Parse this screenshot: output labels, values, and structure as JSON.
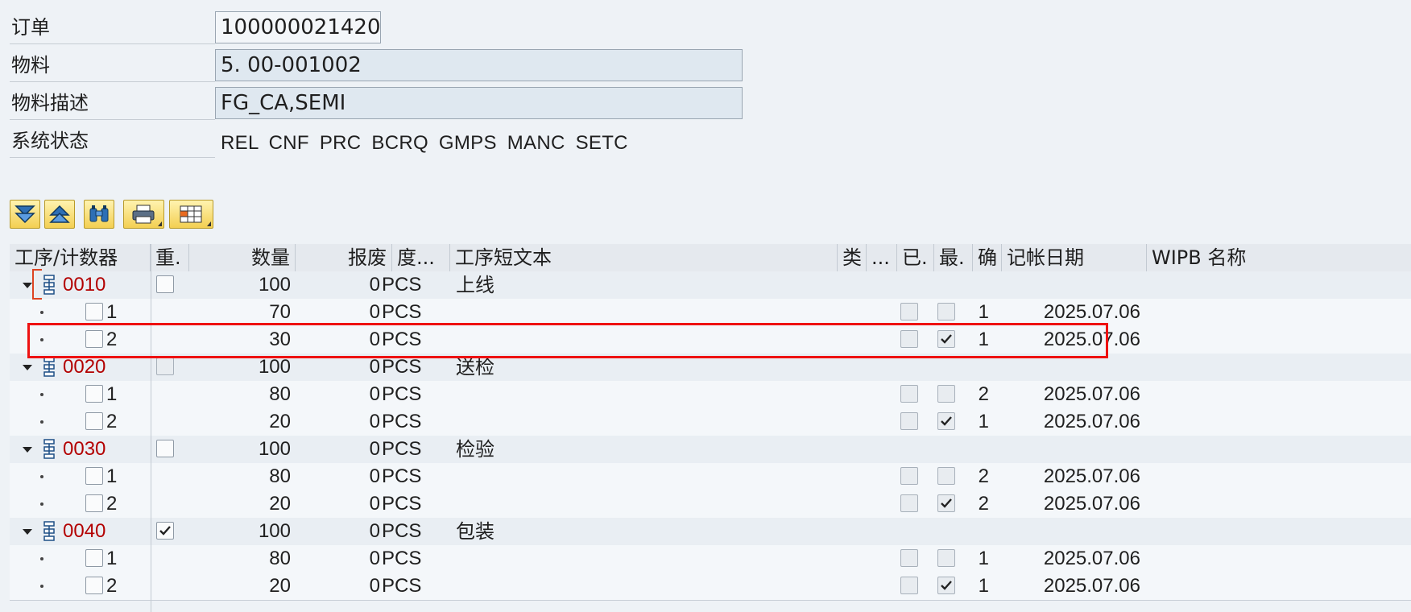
{
  "header": {
    "order_label": "订单",
    "order_value": "100000021420",
    "material_label": "物料",
    "material_value": "5. 00-001002",
    "desc_label": "物料描述",
    "desc_value": "FG_CA,SEMI",
    "status_label": "系统状态",
    "status_value": "REL  CNF  PRC  BCRQ GMPS MANC SETC"
  },
  "toolbar": {
    "buttons": [
      "expand-all-icon",
      "collapse-all-icon",
      "find-icon",
      "print-icon",
      "layout-icon"
    ]
  },
  "grid": {
    "columns": [
      "工序/计数器",
      "重.",
      "数量",
      "报废",
      "度...",
      "工序短文本",
      "类",
      "...",
      "已.",
      "最.",
      "确",
      "记帐日期",
      "WIPB 名称"
    ],
    "operations": [
      {
        "op": "0010",
        "rework": false,
        "qty": "100",
        "scrap": "0",
        "unit": "PCS",
        "text": "上线",
        "counters": [
          {
            "counter": "1",
            "qty": "70",
            "scrap": "0",
            "unit": "PCS",
            "done": false,
            "final": false,
            "conf": "1",
            "date": "2025.07.06"
          },
          {
            "counter": "2",
            "qty": "30",
            "scrap": "0",
            "unit": "PCS",
            "done": false,
            "final": true,
            "conf": "1",
            "date": "2025.07.06"
          }
        ]
      },
      {
        "op": "0020",
        "rework": false,
        "qty": "100",
        "scrap": "0",
        "unit": "PCS",
        "text": "送检",
        "counters": [
          {
            "counter": "1",
            "qty": "80",
            "scrap": "0",
            "unit": "PCS",
            "done": false,
            "final": false,
            "conf": "2",
            "date": "2025.07.06"
          },
          {
            "counter": "2",
            "qty": "20",
            "scrap": "0",
            "unit": "PCS",
            "done": false,
            "final": true,
            "conf": "1",
            "date": "2025.07.06"
          }
        ]
      },
      {
        "op": "0030",
        "rework": false,
        "qty": "100",
        "scrap": "0",
        "unit": "PCS",
        "text": "检验",
        "counters": [
          {
            "counter": "1",
            "qty": "80",
            "scrap": "0",
            "unit": "PCS",
            "done": false,
            "final": false,
            "conf": "2",
            "date": "2025.07.06"
          },
          {
            "counter": "2",
            "qty": "20",
            "scrap": "0",
            "unit": "PCS",
            "done": false,
            "final": true,
            "conf": "2",
            "date": "2025.07.06"
          }
        ]
      },
      {
        "op": "0040",
        "rework": true,
        "qty": "100",
        "scrap": "0",
        "unit": "PCS",
        "text": "包装",
        "counters": [
          {
            "counter": "1",
            "qty": "80",
            "scrap": "0",
            "unit": "PCS",
            "done": false,
            "final": false,
            "conf": "1",
            "date": "2025.07.06"
          },
          {
            "counter": "2",
            "qty": "20",
            "scrap": "0",
            "unit": "PCS",
            "done": false,
            "final": true,
            "conf": "1",
            "date": "2025.07.06"
          }
        ]
      }
    ]
  }
}
